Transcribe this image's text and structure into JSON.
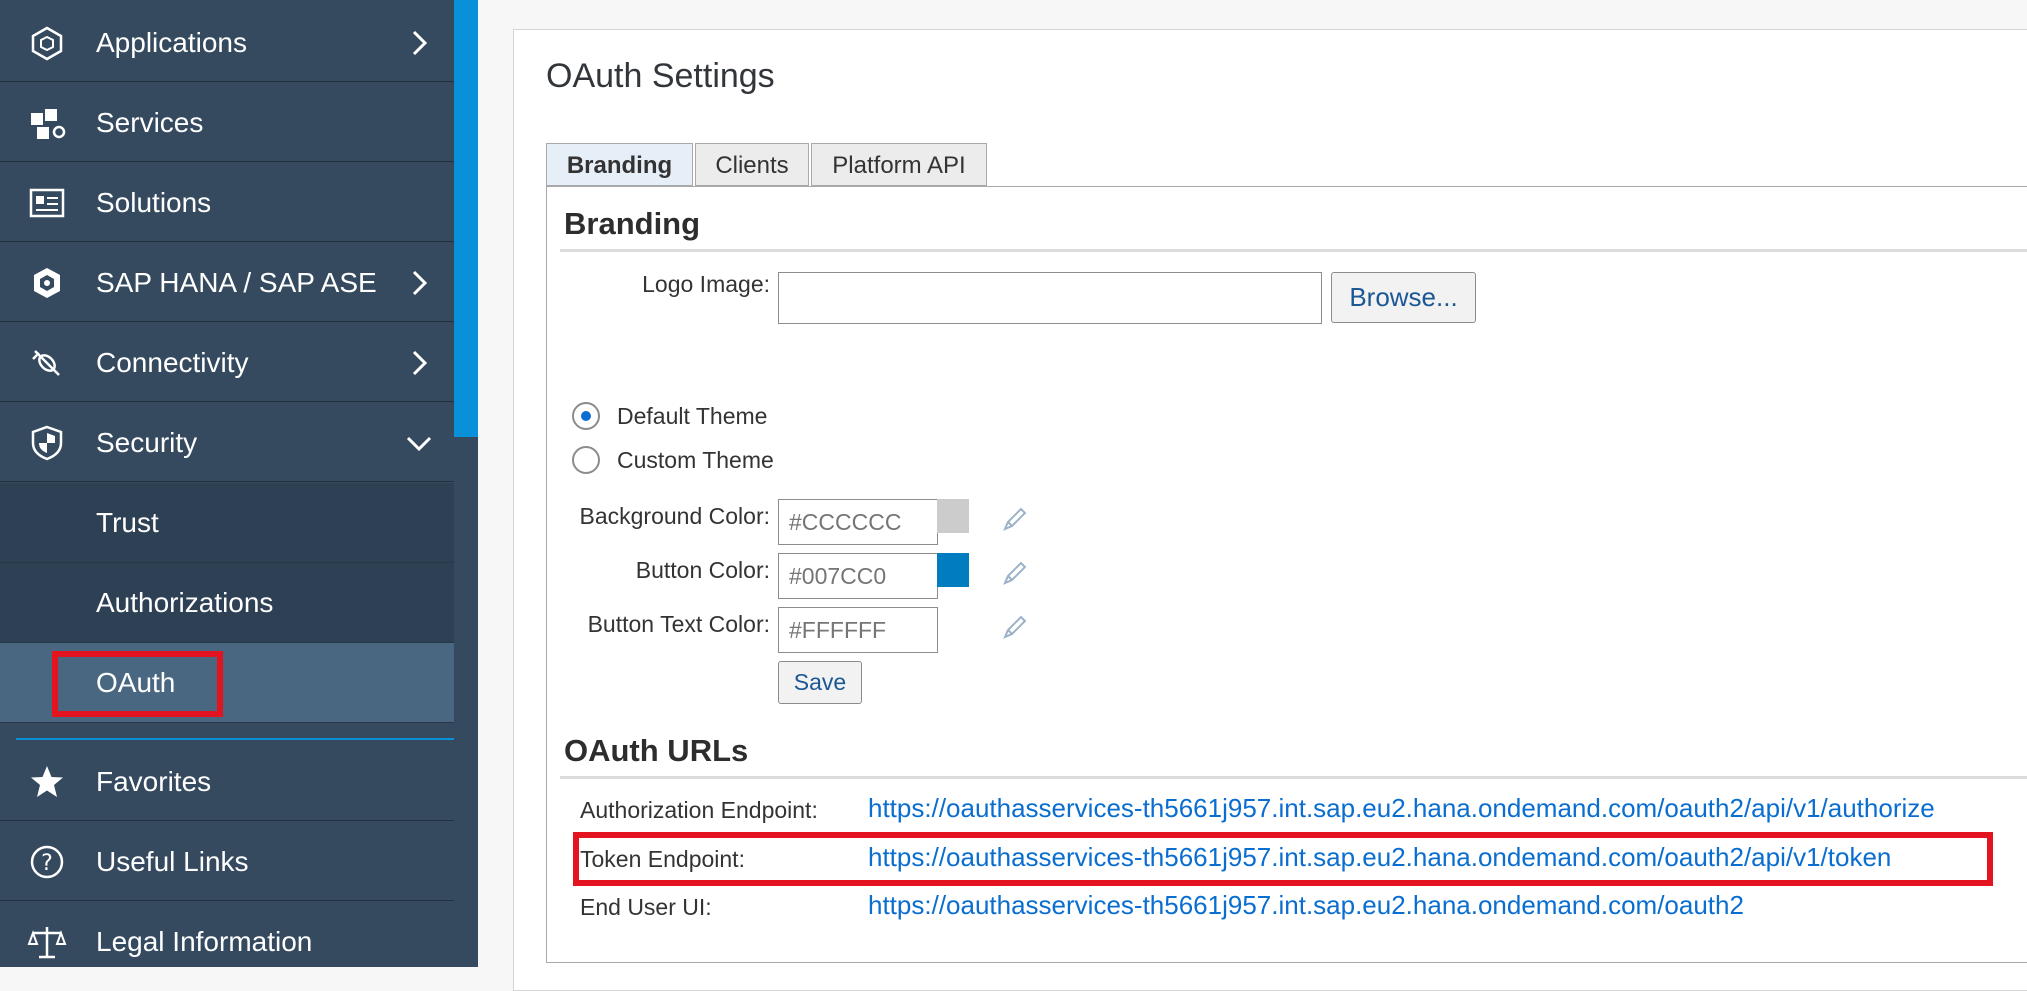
{
  "sidebar": {
    "items": [
      {
        "label": "Applications",
        "icon": "applications-icon",
        "chevron": "right"
      },
      {
        "label": "Services",
        "icon": "services-icon",
        "chevron": ""
      },
      {
        "label": "Solutions",
        "icon": "solutions-icon",
        "chevron": ""
      },
      {
        "label": "SAP HANA / SAP ASE",
        "icon": "database-icon",
        "chevron": "right"
      },
      {
        "label": "Connectivity",
        "icon": "connectivity-icon",
        "chevron": "right"
      },
      {
        "label": "Security",
        "icon": "shield-icon",
        "chevron": "down"
      }
    ],
    "security_subitems": [
      {
        "label": "Trust"
      },
      {
        "label": "Authorizations"
      },
      {
        "label": "OAuth",
        "active": true
      }
    ],
    "bottom_items": [
      {
        "label": "Favorites",
        "icon": "star-icon"
      },
      {
        "label": "Useful Links",
        "icon": "question-icon"
      },
      {
        "label": "Legal Information",
        "icon": "scales-icon"
      }
    ]
  },
  "main": {
    "title": "OAuth Settings",
    "tabs": [
      {
        "label": "Branding",
        "active": true
      },
      {
        "label": "Clients"
      },
      {
        "label": "Platform API"
      }
    ],
    "branding": {
      "heading": "Branding",
      "logo_label": "Logo Image:",
      "logo_value": "",
      "browse_label": "Browse...",
      "themes": [
        {
          "label": "Default Theme",
          "checked": true
        },
        {
          "label": "Custom Theme",
          "checked": false
        }
      ],
      "colors": [
        {
          "label": "Background Color:",
          "placeholder": "#CCCCCC",
          "swatch": "#CCCCCC"
        },
        {
          "label": "Button Color:",
          "placeholder": "#007CC0",
          "swatch": "#007CC0"
        },
        {
          "label": "Button Text Color:",
          "placeholder": "#FFFFFF",
          "swatch": ""
        }
      ],
      "save_label": "Save"
    },
    "oauth_urls": {
      "heading": "OAuth URLs",
      "rows": [
        {
          "label": "Authorization Endpoint:",
          "url": "https://oauthasservices-th5661j957.int.sap.eu2.hana.ondemand.com/oauth2/api/v1/authorize"
        },
        {
          "label": "Token Endpoint:",
          "url": "https://oauthasservices-th5661j957.int.sap.eu2.hana.ondemand.com/oauth2/api/v1/token"
        },
        {
          "label": "End User UI:",
          "url": "https://oauthasservices-th5661j957.int.sap.eu2.hana.ondemand.com/oauth2"
        }
      ]
    }
  },
  "colors": {
    "sidebar_bg": "#354a5f",
    "accent": "#0a8fd9",
    "highlight": "#e3141f",
    "link": "#0a6ed1"
  }
}
